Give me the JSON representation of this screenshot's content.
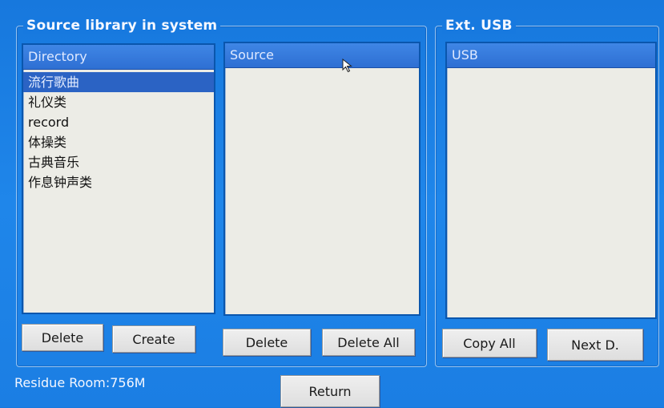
{
  "source_group": {
    "title": "Source library in system",
    "directory": {
      "header": "Directory",
      "items": [
        {
          "label": "流行歌曲",
          "selected": true
        },
        {
          "label": "礼仪类",
          "selected": false
        },
        {
          "label": "record",
          "selected": false
        },
        {
          "label": "体操类",
          "selected": false
        },
        {
          "label": "古典音乐",
          "selected": false
        },
        {
          "label": "作息钟声类",
          "selected": false
        }
      ]
    },
    "source": {
      "header": "Source",
      "items": []
    },
    "buttons": {
      "delete_dir": "Delete",
      "create": "Create",
      "delete_source": "Delete",
      "delete_all": "Delete All"
    }
  },
  "usb_group": {
    "title": "Ext. USB",
    "usb": {
      "header": "USB",
      "items": []
    },
    "buttons": {
      "copy_all": "Copy All",
      "next_d": "Next D."
    }
  },
  "footer": {
    "residue": "Residue Room:756M",
    "return_label": "Return"
  },
  "colors": {
    "background": "#1b7ee3",
    "list_bg": "#ecece6",
    "header_bg": "#2e6fd3",
    "selection": "#2b63c4"
  },
  "icons": {
    "cursor": "mouse-pointer-icon"
  }
}
